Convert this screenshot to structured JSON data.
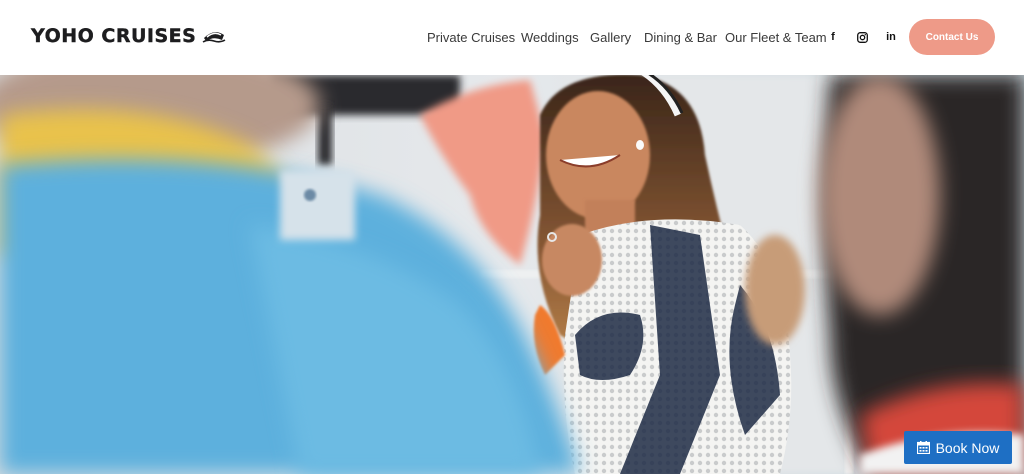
{
  "brand": {
    "name": "YOHO CRUISES",
    "logo_icon": "ship-icon"
  },
  "nav": {
    "items": [
      {
        "label": "Private Cruises"
      },
      {
        "label": "Weddings"
      },
      {
        "label": "Gallery"
      },
      {
        "label": "Dining & Bar"
      },
      {
        "label": "Our Fleet & Team"
      }
    ],
    "social": [
      {
        "icon": "facebook-icon",
        "glyph": "f"
      },
      {
        "icon": "instagram-icon",
        "glyph": ""
      },
      {
        "icon": "linkedin-icon",
        "glyph": "in"
      }
    ],
    "contact_label": "Contact Us"
  },
  "hero": {
    "image": "smiling-woman-on-boat-photo"
  },
  "booking": {
    "label": "Book Now",
    "icon": "calendar-icon"
  },
  "colors": {
    "accent": "#ee9a88",
    "book_button": "#1e6fc4",
    "text": "#3a3a3a"
  }
}
